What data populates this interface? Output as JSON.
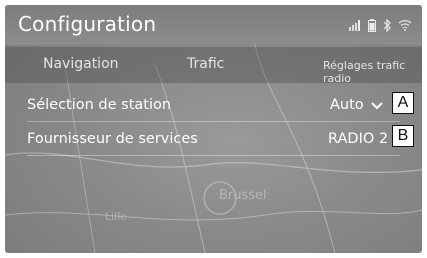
{
  "header": {
    "title": "Configuration"
  },
  "status_icons": [
    "signal-icon",
    "phone-battery-icon",
    "bluetooth-icon",
    "wifi-icon"
  ],
  "tabs": [
    {
      "label": "Navigation"
    },
    {
      "label": "Trafic"
    },
    {
      "label": "Réglages trafic radio"
    }
  ],
  "settings": [
    {
      "label": "Sélection de station",
      "value": "Auto",
      "callout": "A"
    },
    {
      "label": "Fournisseur de services",
      "value": "RADIO 2",
      "callout": "B"
    }
  ],
  "map_labels": [
    "Brussel",
    "Lille"
  ]
}
